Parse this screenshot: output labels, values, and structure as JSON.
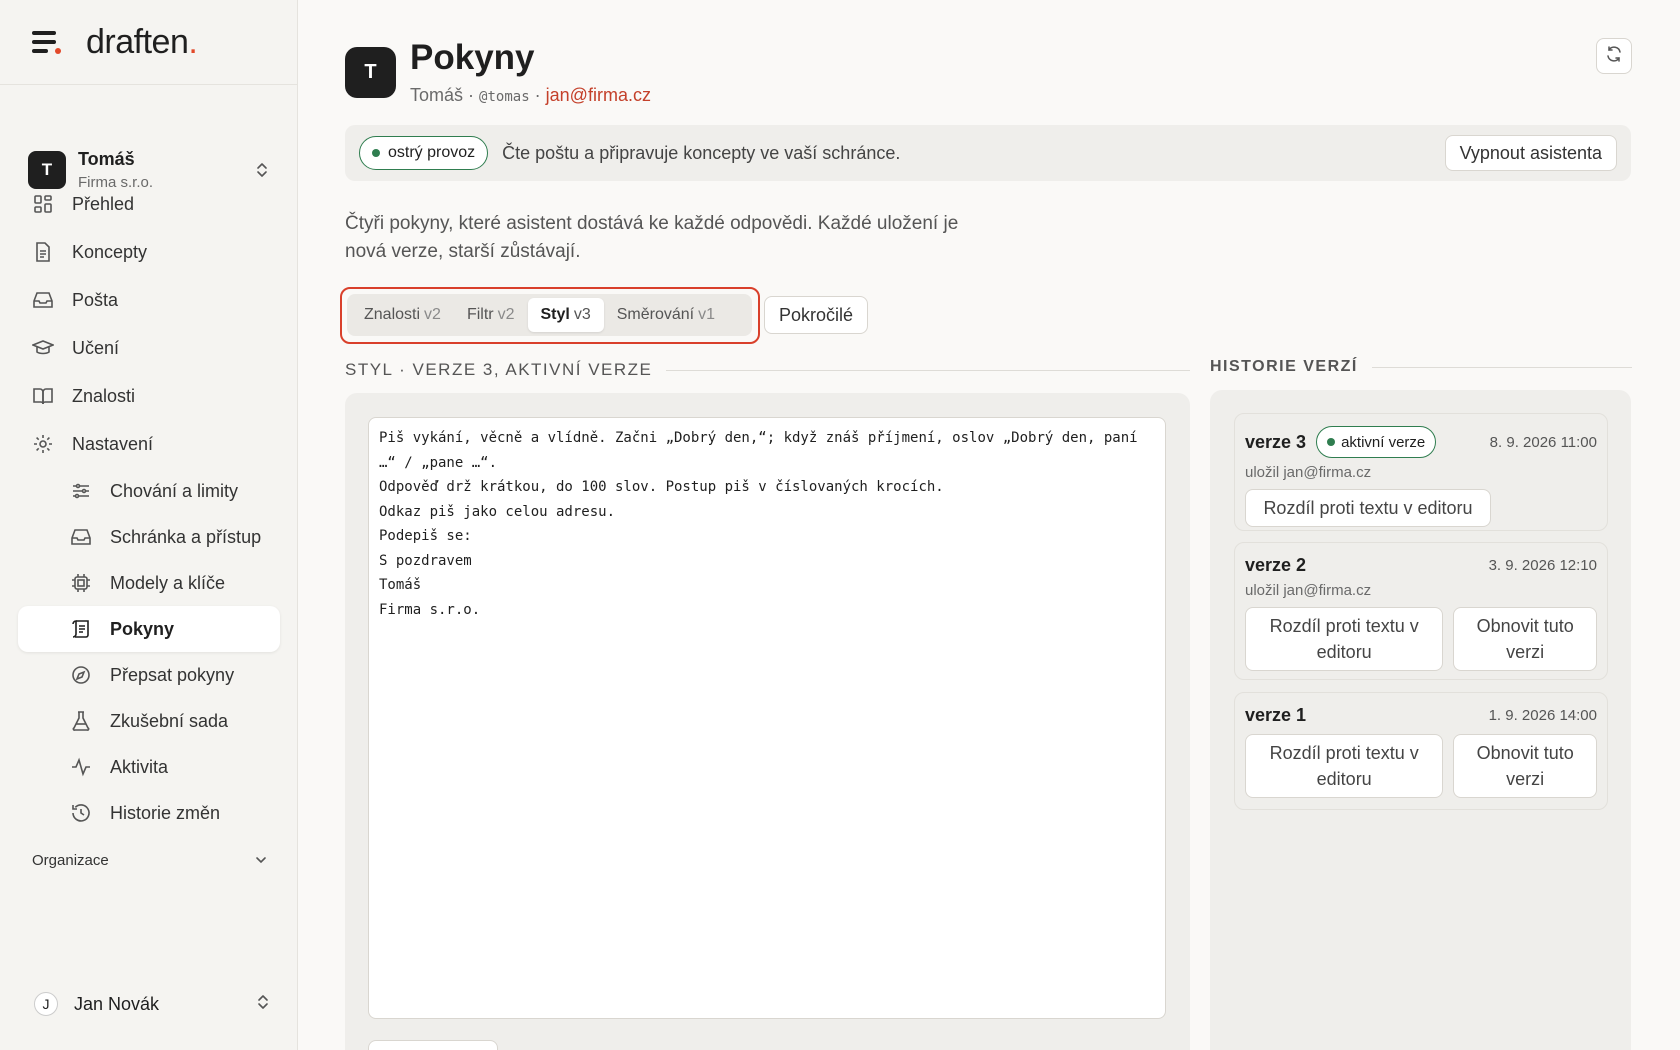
{
  "brand": {
    "name": "draften",
    "accent": "."
  },
  "account": {
    "initial": "T",
    "name": "Tomáš",
    "org": "Firma s.r.o."
  },
  "nav": {
    "items": [
      {
        "label": "Přehled",
        "icon": "grid-icon"
      },
      {
        "label": "Koncepty",
        "icon": "document-icon"
      },
      {
        "label": "Pošta",
        "icon": "inbox-icon"
      },
      {
        "label": "Učení",
        "icon": "graduation-cap-icon"
      },
      {
        "label": "Znalosti",
        "icon": "book-icon"
      },
      {
        "label": "Nastavení",
        "icon": "gear-icon"
      }
    ],
    "sub_items": [
      {
        "label": "Chování a limity",
        "icon": "sliders-icon"
      },
      {
        "label": "Schránka a přístup",
        "icon": "inbox-icon"
      },
      {
        "label": "Modely a klíče",
        "icon": "chip-icon"
      },
      {
        "label": "Pokyny",
        "icon": "scroll-icon",
        "active": true
      },
      {
        "label": "Přepsat pokyny",
        "icon": "compass-icon"
      },
      {
        "label": "Zkušební sada",
        "icon": "flask-icon"
      },
      {
        "label": "Aktivita",
        "icon": "activity-icon"
      },
      {
        "label": "Historie změn",
        "icon": "history-icon"
      }
    ],
    "org_section": "Organizace"
  },
  "user": {
    "initial": "J",
    "name": "Jan Novák"
  },
  "header": {
    "initial": "T",
    "title": "Pokyny",
    "sub_name": "Tomáš",
    "sub_sep": "·",
    "handle": "@tomas",
    "email": "jan@firma.cz"
  },
  "status": {
    "pill": "ostrý provoz",
    "text": "Čte poštu a připravuje koncepty ve vaší schránce.",
    "button": "Vypnout asistenta"
  },
  "intro": "Čtyři pokyny, které asistent dostává ke každé odpovědi. Každé uložení je nová verze, starší zůstávají.",
  "tabs": [
    {
      "label": "Znalosti",
      "ver": "v2"
    },
    {
      "label": "Filtr",
      "ver": "v2"
    },
    {
      "label": "Styl",
      "ver": "v3",
      "active": true
    },
    {
      "label": "Směrování",
      "ver": "v1"
    }
  ],
  "advanced_button": "Pokročilé",
  "section_title": "STYL · VERZE 3, AKTIVNÍ VERZE",
  "editor_text": "Piš vykání, věcně a vlídně. Začni „Dobrý den,“; když znáš příjmení, oslov „Dobrý den, paní …“ / „pane …“.\nOdpověď drž krátkou, do 100 slov. Postup piš v číslovaných krocích.\nOdkaz piš jako celou adresu.\nPodepiš se:\nS pozdravem\nTomáš\nFirma s.r.o.",
  "history": {
    "title": "HISTORIE VERZÍ",
    "versions": [
      {
        "name": "verze 3",
        "badge": "aktivní verze",
        "date": "8. 9. 2026 11:00",
        "by": "uložil jan@firma.cz",
        "diff": "Rozdíl proti textu v editoru"
      },
      {
        "name": "verze 2",
        "date": "3. 9. 2026 12:10",
        "by": "uložil jan@firma.cz",
        "diff": "Rozdíl proti textu v editoru",
        "restore": "Obnovit tuto verzi"
      },
      {
        "name": "verze 1",
        "date": "1. 9. 2026 14:00",
        "diff": "Rozdíl proti textu v editoru",
        "restore": "Obnovit tuto verzi"
      }
    ]
  },
  "colors": {
    "accent": "#e2492a",
    "live_green": "#2f7d4f",
    "email": "#c4402a",
    "highlight_outline": "#d9402b"
  }
}
